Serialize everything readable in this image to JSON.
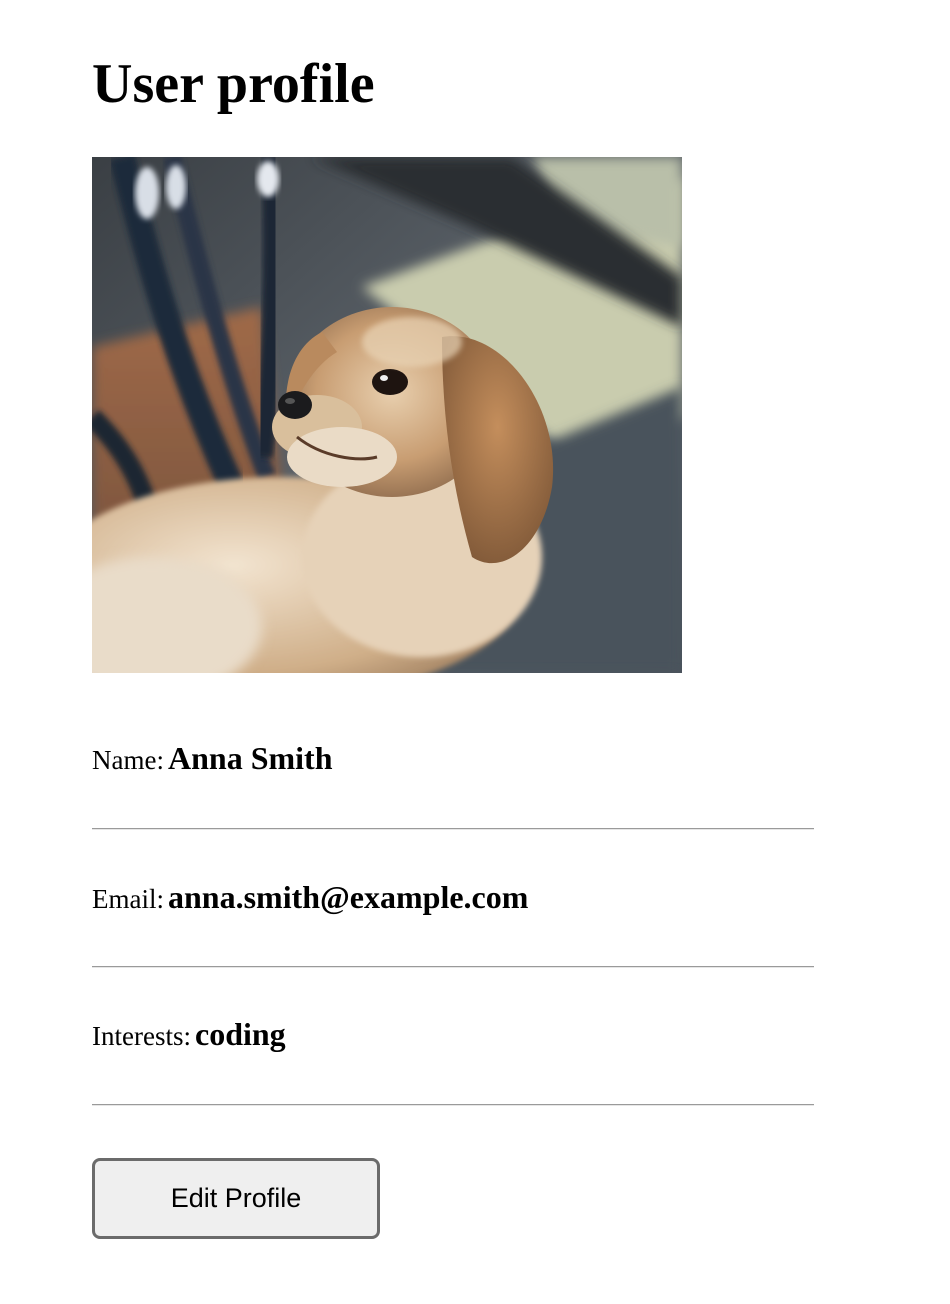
{
  "page": {
    "title": "User profile"
  },
  "avatar": {
    "alt": "profile photo of a small fluffy dog"
  },
  "profile": {
    "name": {
      "label": "Name:",
      "value": "Anna Smith"
    },
    "email": {
      "label": "Email:",
      "value": "anna.smith@example.com"
    },
    "interests": {
      "label": "Interests:",
      "value": "coding"
    }
  },
  "actions": {
    "edit_label": "Edit Profile"
  }
}
